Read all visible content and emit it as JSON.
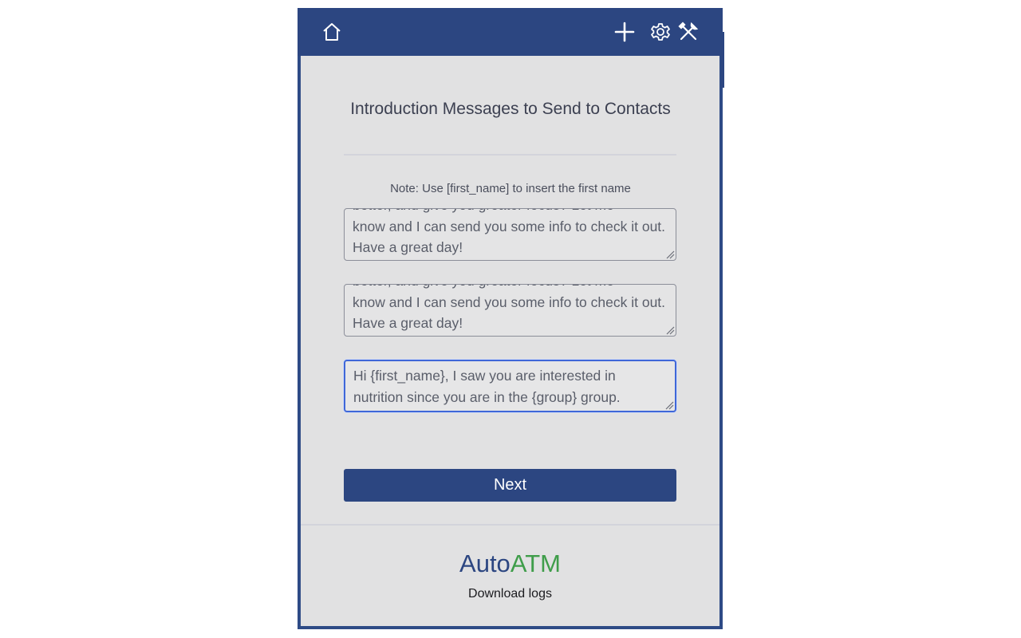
{
  "toolbar": {
    "home_icon": "home-icon",
    "add_icon": "plus-icon",
    "settings_icon": "gear-icon",
    "tools_icon": "tools-icon",
    "bg_color": "#2c4681"
  },
  "main": {
    "title": "Introduction Messages to Send to Contacts",
    "note": "Note: Use [first_name] to insert the first name",
    "messages": [
      {
        "partial_line": "better, and give you greater focus? Let me",
        "value": "know and I can send you some info to check it out. Have a great day!"
      },
      {
        "partial_line": "better, and give you greater focus? Let me",
        "value": "know and I can send you some info to check it out. Have a great day!"
      },
      {
        "value": "Hi {first_name}, I saw you are interested in nutrition since you are in the {group} group."
      }
    ],
    "next_label": "Next"
  },
  "footer": {
    "brand_part1": "Auto",
    "brand_part2": "ATM",
    "brand_color1": "#2c4681",
    "brand_color2": "#3f9d4a",
    "download_label": "Download logs"
  }
}
